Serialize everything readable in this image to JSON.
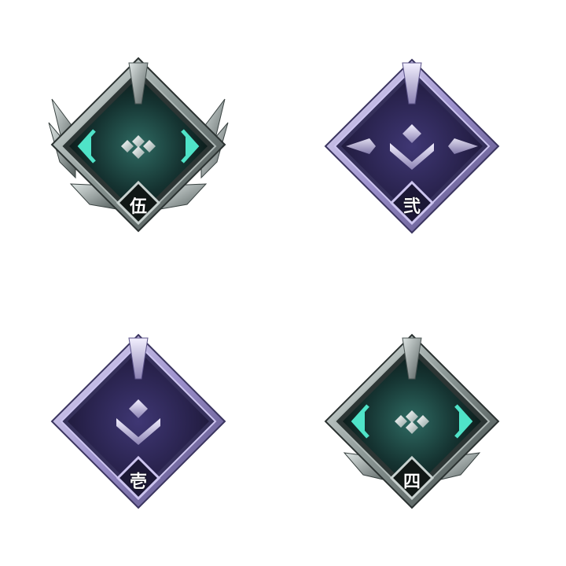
{
  "badges": [
    {
      "numeral": "伍",
      "style": "silver-teal",
      "winged": true
    },
    {
      "numeral": "弐",
      "style": "violet",
      "winged": false
    },
    {
      "numeral": "壱",
      "style": "violet",
      "winged": false
    },
    {
      "numeral": "四",
      "style": "silver-teal",
      "winged": true
    }
  ],
  "colors": {
    "teal_glow": "#4fe3c8",
    "silver": "#c9d2d0",
    "dark_silver": "#5d6866",
    "violet_frame": "#a79bd6",
    "violet_fill": "#2a2450",
    "teal_fill": "#12302d"
  }
}
